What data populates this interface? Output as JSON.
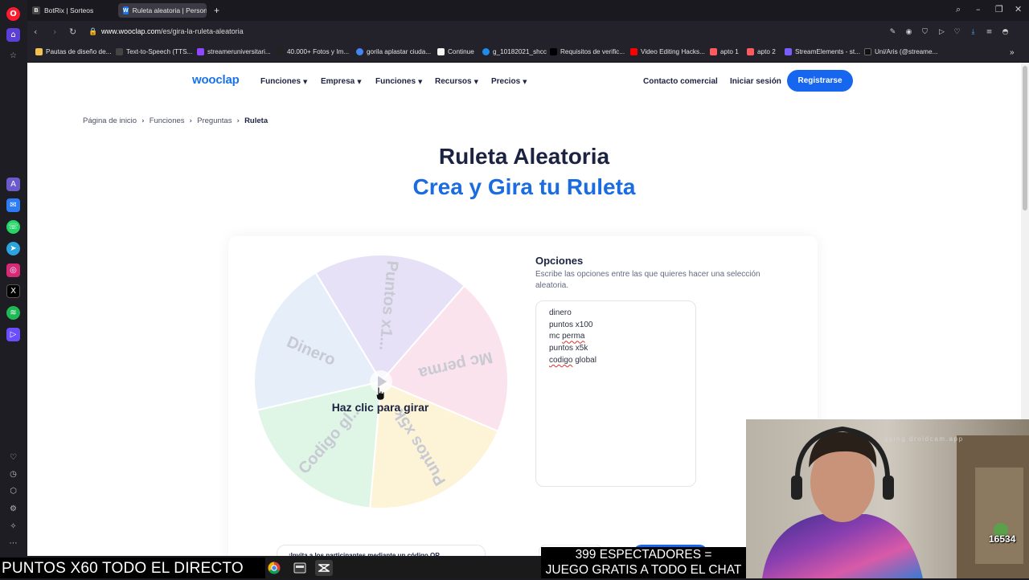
{
  "browser": {
    "tabs": [
      {
        "label": "BotRix | Sorteos",
        "favicon": "B"
      },
      {
        "label": "Ruleta aleatoria | Personal",
        "favicon": "W"
      }
    ],
    "new_tab": "+",
    "url_host": "www.wooclap.com",
    "url_path": "/es/gira-la-ruleta-aleatoria",
    "bookmarks": [
      {
        "label": "Pautas de diseño de...",
        "color": "#f2c14e"
      },
      {
        "label": "Text-to-Speech (TTS...",
        "color": "#444444"
      },
      {
        "label": "streameruniversitari...",
        "color": "#9146ff"
      },
      {
        "label": "40.000+ Fotos y Im...",
        "color": "#222222"
      },
      {
        "label": "gorila aplastar ciuda...",
        "color": "#4285f4"
      },
      {
        "label": "Continue",
        "color": "#f5f5f5"
      },
      {
        "label": "g_10182021_shcc",
        "color": "#1f8ceb"
      },
      {
        "label": "Requisitos de verific...",
        "color": "#000000"
      },
      {
        "label": "Video Editing Hacks...",
        "color": "#ff0000"
      },
      {
        "label": "apto 1",
        "color": "#ff5a5f"
      },
      {
        "label": "apto 2",
        "color": "#ff5a5f"
      },
      {
        "label": "StreamElements - st...",
        "color": "#7b5cff"
      },
      {
        "label": "Uni/Aris (@streame...",
        "color": "#111111"
      }
    ]
  },
  "site": {
    "logo": "wooclap",
    "nav": [
      "Funciones",
      "Empresa",
      "Funciones",
      "Recursos",
      "Precios"
    ],
    "contact": "Contacto comercial",
    "login": "Iniciar sesión",
    "register": "Registrarse",
    "breadcrumb": [
      "Página de inicio",
      "Funciones",
      "Preguntas",
      "Ruleta"
    ],
    "title": "Ruleta Aleatoria",
    "subtitle": "Crea y Gira tu Ruleta",
    "wheel": {
      "segments": [
        {
          "label": "Puntos x1...",
          "color": "#e6e1f6"
        },
        {
          "label": "Mc perma",
          "color": "#fbe3ee"
        },
        {
          "label": "Puntos x5k",
          "color": "#fdf3d7"
        },
        {
          "label": "Codigo gl...",
          "color": "#dff5e6"
        },
        {
          "label": "Dinero",
          "color": "#e6eef9"
        }
      ],
      "spin_label": "Haz clic para girar"
    },
    "options_title": "Opciones",
    "options_desc": "Escribe las opciones entre las que quieres hacer una selección aleatoria.",
    "options": [
      "dinero",
      "puntos x100",
      "mc perma",
      "puntos x5k",
      "codigo global"
    ],
    "qr_text": "¡Invita a los participantes mediante un código QR"
  },
  "overlay": {
    "left_banner": "PUNTOS X60 TODO EL DIRECTO",
    "right_banner_line1": "399 ESPECTADORES =",
    "right_banner_line2": "JUEGO GRATIS A TODO EL CHAT",
    "webcam_watermark": "using droidcam.app",
    "viewer_count": "16534"
  }
}
